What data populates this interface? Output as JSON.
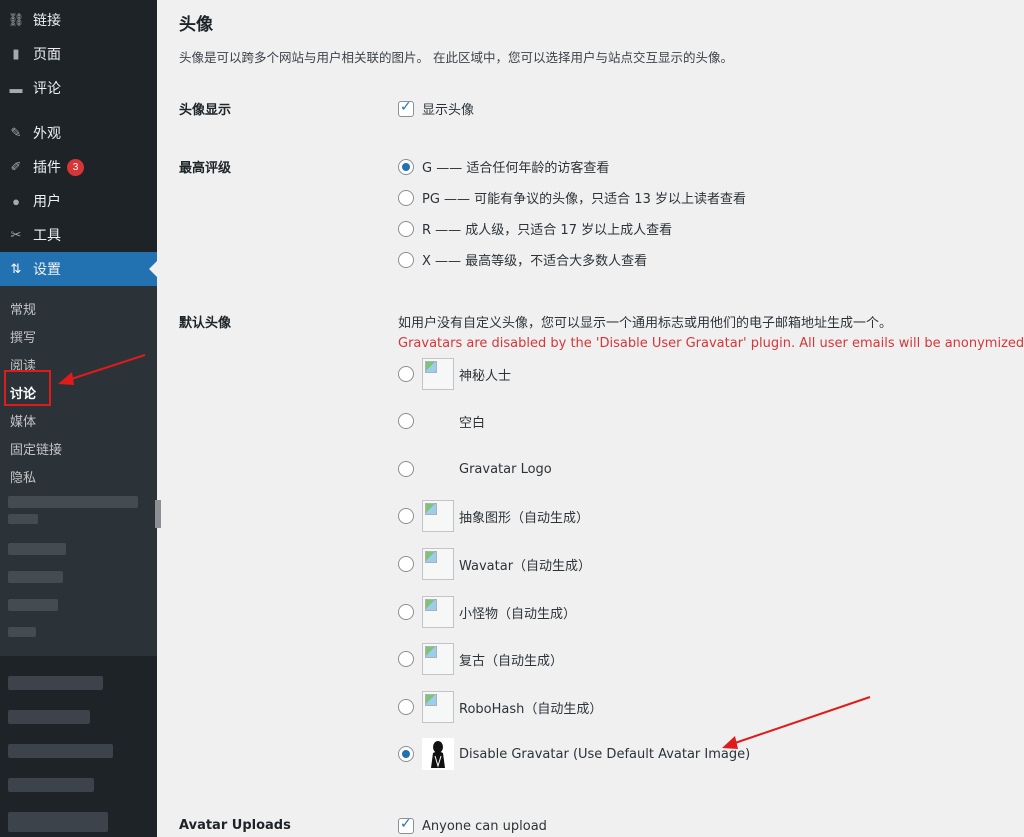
{
  "sidebar": {
    "items": [
      {
        "label": "链接",
        "icon": "link-icon",
        "glyph": "🔗"
      },
      {
        "label": "页面",
        "icon": "page-icon",
        "glyph": "▮"
      },
      {
        "label": "评论",
        "icon": "comment-icon",
        "glyph": "▬"
      },
      {
        "label": "外观",
        "icon": "appearance-icon",
        "glyph": "✎"
      },
      {
        "label": "插件",
        "icon": "plugin-icon",
        "glyph": "⚡",
        "badge": "3"
      },
      {
        "label": "用户",
        "icon": "user-icon",
        "glyph": "●"
      },
      {
        "label": "工具",
        "icon": "tools-icon",
        "glyph": "🔧"
      },
      {
        "label": "设置",
        "icon": "settings-icon",
        "glyph": "⇅"
      }
    ],
    "submenu": [
      "常规",
      "撰写",
      "阅读",
      "讨论",
      "媒体",
      "固定链接",
      "隐私"
    ],
    "current_submenu": "讨论"
  },
  "main": {
    "title": "头像",
    "description": "头像是可以跨多个网站与用户相关联的图片。 在此区域中，您可以选择用户与站点交互显示的头像。",
    "avatar_display": {
      "label": "头像显示",
      "checkbox": "显示头像",
      "checked": true
    },
    "max_rating": {
      "label": "最高评级",
      "options": [
        {
          "text": "G —— 适合任何年龄的访客查看",
          "checked": true
        },
        {
          "text": "PG —— 可能有争议的头像，只适合 13 岁以上读者查看",
          "checked": false
        },
        {
          "text": "R —— 成人级，只适合 17 岁以上成人查看",
          "checked": false
        },
        {
          "text": "X —— 最高等级，不适合大多数人查看",
          "checked": false
        }
      ]
    },
    "default_avatar": {
      "label": "默认头像",
      "note": "如用户没有自定义头像，您可以显示一个通用标志或用他们的电子邮箱地址生成一个。",
      "warning": "Gravatars are disabled by the 'Disable User Gravatar' plugin. All user emails will be anonymized when s",
      "options": [
        {
          "text": "神秘人士",
          "checked": false
        },
        {
          "text": "空白",
          "checked": false
        },
        {
          "text": "Gravatar Logo",
          "checked": false
        },
        {
          "text": "抽象图形（自动生成）",
          "checked": false
        },
        {
          "text": "Wavatar（自动生成）",
          "checked": false
        },
        {
          "text": "小怪物（自动生成）",
          "checked": false
        },
        {
          "text": "复古（自动生成）",
          "checked": false
        },
        {
          "text": "RoboHash（自动生成）",
          "checked": false
        },
        {
          "text": "Disable Gravatar (Use Default Avatar Image)",
          "checked": true
        }
      ]
    },
    "avatar_uploads": {
      "label": "Avatar Uploads",
      "checkbox": "Anyone can upload",
      "checked": true
    }
  },
  "colors": {
    "sidebar_bg": "#1d2327",
    "accent": "#2271b1",
    "badge": "#d63638",
    "warning": "#d63638",
    "annotation": "#e01b1b"
  }
}
